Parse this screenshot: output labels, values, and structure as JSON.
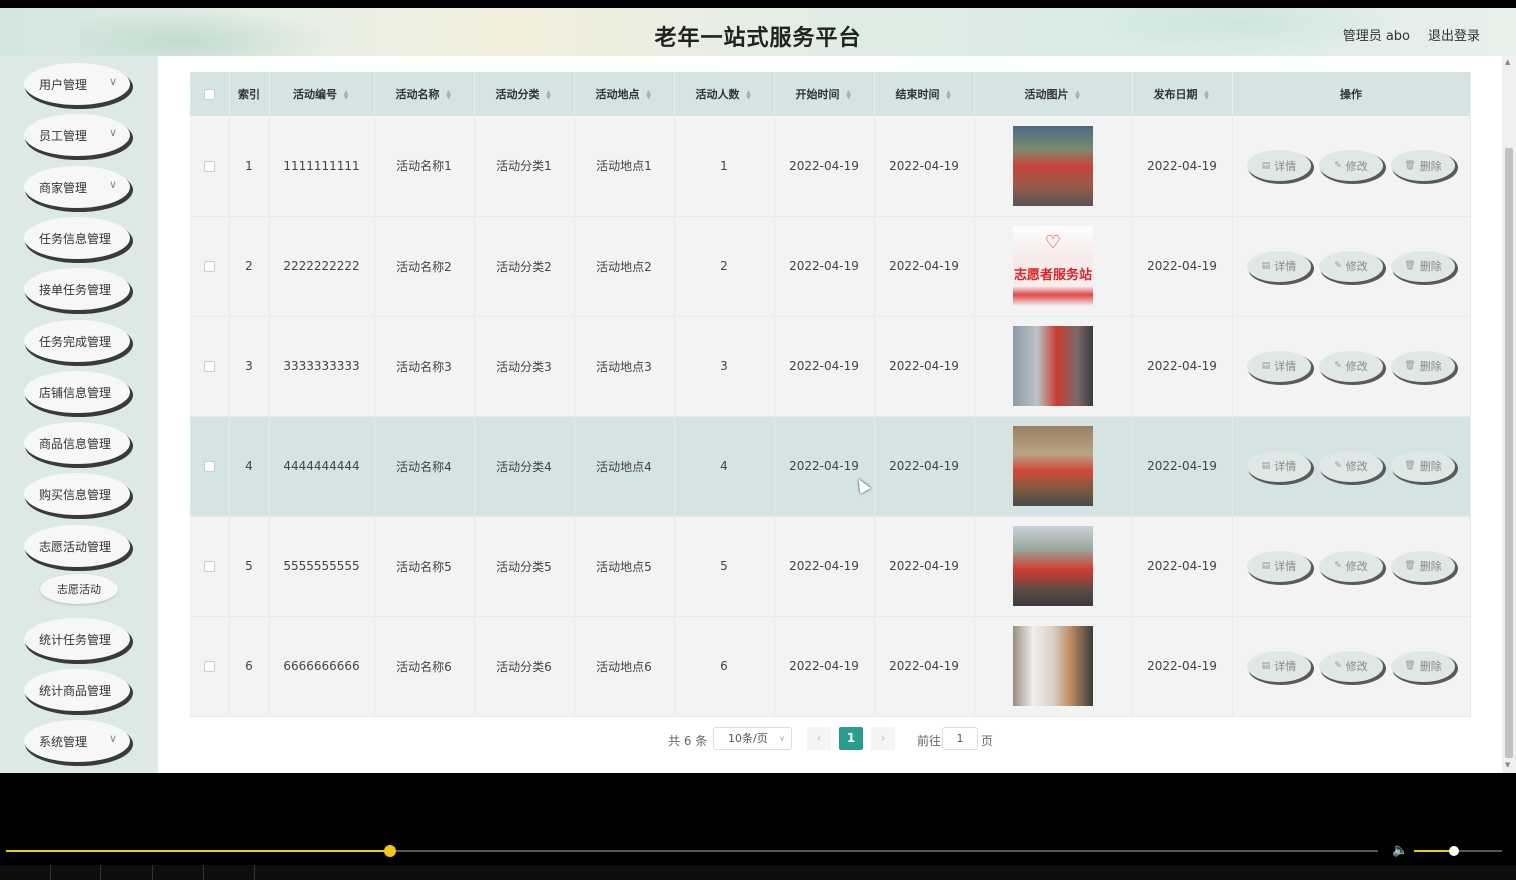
{
  "header": {
    "title": "老年一站式服务平台",
    "admin": "管理员 abo",
    "logout": "退出登录"
  },
  "sidebar": {
    "items": [
      {
        "label": "用户管理",
        "chevron": true
      },
      {
        "label": "员工管理",
        "chevron": true
      },
      {
        "label": "商家管理",
        "chevron": true
      },
      {
        "label": "任务信息管理",
        "chevron": false
      },
      {
        "label": "接单任务管理",
        "chevron": false
      },
      {
        "label": "任务完成管理",
        "chevron": false
      },
      {
        "label": "店铺信息管理",
        "chevron": false
      },
      {
        "label": "商品信息管理",
        "chevron": false
      },
      {
        "label": "购买信息管理",
        "chevron": false
      },
      {
        "label": "志愿活动管理",
        "chevron": false
      },
      {
        "label": "统计任务管理",
        "chevron": false
      },
      {
        "label": "统计商品管理",
        "chevron": false
      },
      {
        "label": "系统管理",
        "chevron": true
      }
    ],
    "sub_item": "志愿活动"
  },
  "table": {
    "columns": [
      "索引",
      "活动编号",
      "活动名称",
      "活动分类",
      "活动地点",
      "活动人数",
      "开始时间",
      "结束时间",
      "活动图片",
      "发布日期",
      "操作"
    ],
    "rows": [
      {
        "index": "1",
        "code": "1111111111",
        "name": "活动名称1",
        "category": "活动分类1",
        "place": "活动地点1",
        "count": "1",
        "start": "2022-04-19",
        "end": "2022-04-19",
        "image": "volunteers-photo",
        "publish": "2022-04-19"
      },
      {
        "index": "2",
        "code": "2222222222",
        "name": "活动名称2",
        "category": "活动分类2",
        "place": "活动地点2",
        "count": "2",
        "start": "2022-04-19",
        "end": "2022-04-19",
        "image": "volunteer-station-poster",
        "publish": "2022-04-19"
      },
      {
        "index": "3",
        "code": "3333333333",
        "name": "活动名称3",
        "category": "活动分类3",
        "place": "活动地点3",
        "count": "3",
        "start": "2022-04-19",
        "end": "2022-04-19",
        "image": "street-volunteer-photo",
        "publish": "2022-04-19"
      },
      {
        "index": "4",
        "code": "4444444444",
        "name": "活动名称4",
        "category": "活动分类4",
        "place": "活动地点4",
        "count": "4",
        "start": "2022-04-19",
        "end": "2022-04-19",
        "image": "group-photo",
        "publish": "2022-04-19"
      },
      {
        "index": "5",
        "code": "5555555555",
        "name": "活动名称5",
        "category": "活动分类5",
        "place": "活动地点5",
        "count": "5",
        "start": "2022-04-19",
        "end": "2022-04-19",
        "image": "banner-group-photo",
        "publish": "2022-04-19"
      },
      {
        "index": "6",
        "code": "6666666666",
        "name": "活动名称6",
        "category": "活动分类6",
        "place": "活动地点6",
        "count": "6",
        "start": "2022-04-19",
        "end": "2022-04-19",
        "image": "medical-volunteer-photo",
        "publish": "2022-04-19"
      }
    ],
    "poster_text": "志愿者服务站",
    "actions": {
      "detail": "详情",
      "edit": "修改",
      "delete": "删除"
    },
    "highlight_color": "#d5e4e2"
  },
  "pagination": {
    "total": "共 6 条",
    "page_size": "10条/页",
    "current": "1",
    "goto_label": "前往",
    "goto_value": "1",
    "page_unit": "页",
    "accent": "#2a9d8f"
  },
  "player": {
    "progress": 0.28,
    "volume": 0.45,
    "accent": "#f0c814"
  }
}
